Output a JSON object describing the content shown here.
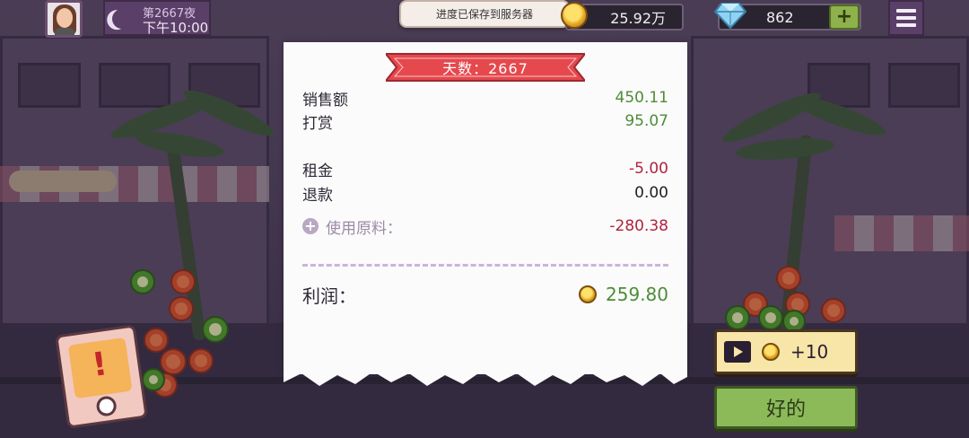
{
  "hud": {
    "day_label": "第2667夜",
    "time_label": "下午10:00",
    "toast": "进度已保存到服务器",
    "coins": "25.92万",
    "gems": "862",
    "gems_plus": "+"
  },
  "receipt": {
    "banner": "天数：2667",
    "rows": {
      "sales": {
        "label": "销售额",
        "value": "450.11"
      },
      "tips": {
        "label": "打赏",
        "value": "95.07"
      },
      "rent": {
        "label": "租金",
        "value": "-5.00"
      },
      "refund": {
        "label": "退款",
        "value": "0.00"
      },
      "ingredients": {
        "label": "使用原料：",
        "value": "-280.38"
      }
    },
    "profit": {
      "label": "利润：",
      "value": "259.80"
    }
  },
  "actions": {
    "ad_reward": "+10",
    "ok": "好的"
  },
  "colors": {
    "positive": "#4e8c38",
    "negative": "#b0243f",
    "banner": "#e5484d",
    "ok_button": "#8cba59"
  },
  "icons": [
    "moon-icon",
    "coin-icon",
    "diamond-icon",
    "plus-icon",
    "menu-icon",
    "play-video-icon",
    "alert-icon"
  ]
}
